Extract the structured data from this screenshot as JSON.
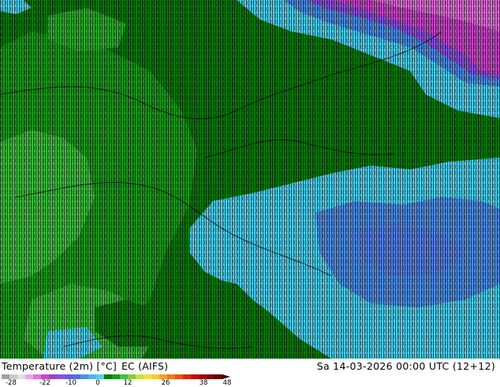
{
  "footer": {
    "parameter": "Temperature (2m) [°C]",
    "model": "EC (AIFS)",
    "datetime": "Sa 14-03-2026 00:00 UTC (12+12)"
  },
  "colorbar": {
    "tick_labels": [
      "-28",
      "-22",
      "-10",
      "0",
      "12",
      "26",
      "38",
      "48"
    ]
  },
  "colors": {
    "dark_green": "#0b7a0b",
    "mid_green": "#1a9c1a",
    "light_green": "#3fc03f",
    "cyan": "#4fd2f0",
    "blue": "#4f8fe6",
    "magenta": "#c848c8",
    "violet": "#8a52e0"
  }
}
